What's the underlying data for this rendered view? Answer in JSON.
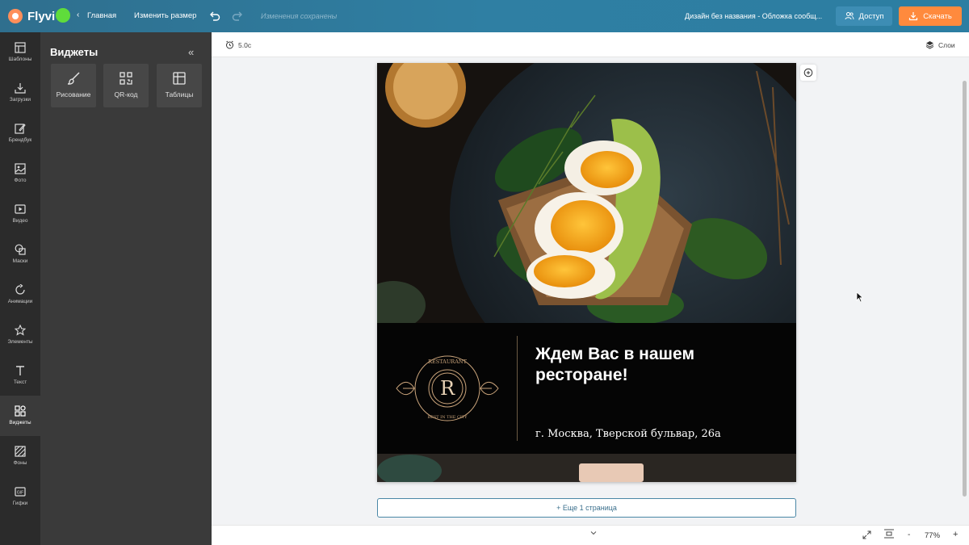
{
  "app": {
    "name": "Flyvi",
    "home_label": "Главная",
    "resize_label": "Изменить размер",
    "save_status": "Изменения сохранены",
    "document_title": "Дизайн без названия - Обложка сообщ...",
    "access_label": "Доступ",
    "download_label": "Скачать"
  },
  "rail": {
    "items": [
      {
        "label": "Шаблоны",
        "icon": "template-icon"
      },
      {
        "label": "Загрузки",
        "icon": "upload-icon"
      },
      {
        "label": "Брендбук",
        "icon": "brandbook-icon"
      },
      {
        "label": "Фото",
        "icon": "photo-icon"
      },
      {
        "label": "Видео",
        "icon": "video-icon"
      },
      {
        "label": "Маски",
        "icon": "masks-icon"
      },
      {
        "label": "Анимации",
        "icon": "animation-icon"
      },
      {
        "label": "Элементы",
        "icon": "star-icon"
      },
      {
        "label": "Текст",
        "icon": "text-icon"
      },
      {
        "label": "Виджеты",
        "icon": "widgets-icon",
        "active": true
      },
      {
        "label": "Фоны",
        "icon": "backgrounds-icon"
      },
      {
        "label": "Гифки",
        "icon": "gif-icon"
      }
    ]
  },
  "panel": {
    "title": "Виджеты",
    "collapse_symbol": "«",
    "widgets": [
      {
        "label": "Рисование",
        "icon": "brush-icon"
      },
      {
        "label": "QR-код",
        "icon": "qr-code-icon"
      },
      {
        "label": "Таблицы",
        "icon": "table-icon"
      }
    ]
  },
  "workspace": {
    "duration": "5.0с",
    "layers_label": "Слои",
    "more_pages": "+ Еще 1 страница"
  },
  "design": {
    "headline": "Ждем Вас в нашем ресторане!",
    "address": "г. Москва, Тверской бульвар, 26а",
    "emblem": {
      "top_text": "RESTAURANT",
      "letter": "R",
      "bottom_text": "BEST IN THE CITY"
    },
    "colors": {
      "band": "#050505",
      "gold": "#c9a37a"
    }
  },
  "zoom": {
    "minus": "-",
    "value": "77%",
    "plus": "+"
  },
  "colors": {
    "topbar": "#2f7fa3",
    "download": "#ff8a3d",
    "status_dot": "#5fdc3b",
    "rail": "#2b2b2b",
    "panel": "#3a3a3a"
  }
}
